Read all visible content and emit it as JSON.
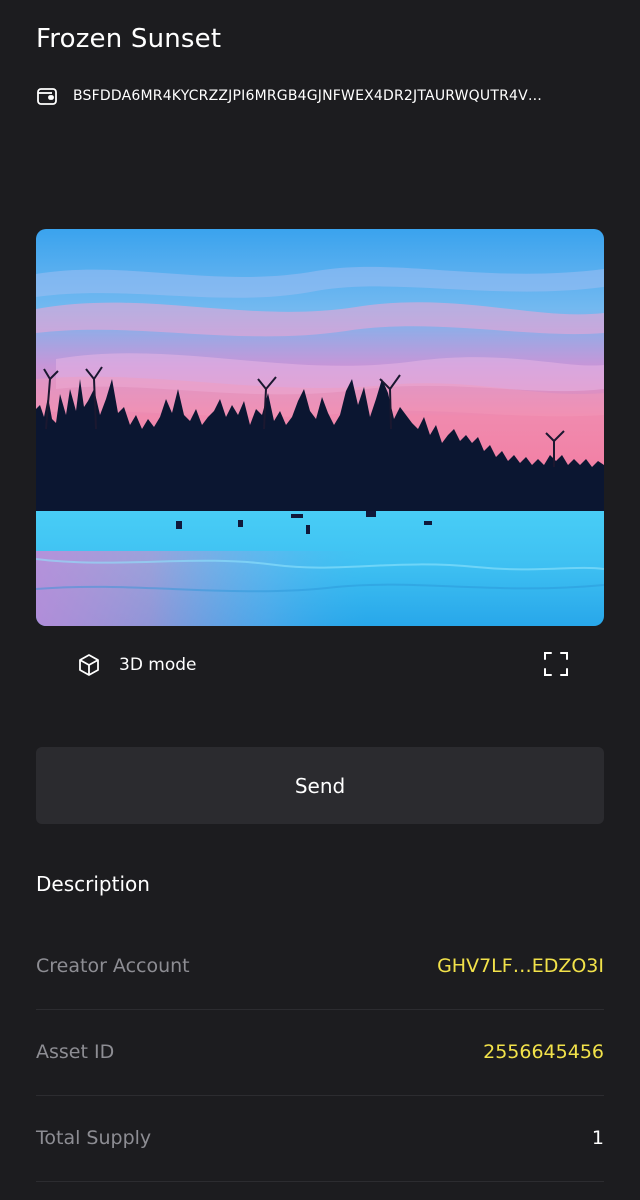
{
  "asset": {
    "name": "Frozen Sunset",
    "address": "BSFDDA6MR4KYCRZZJPI6MRGB4GJNFWEX4DR2JTAURWQUTR4V…"
  },
  "media": {
    "mode_label": "3D mode"
  },
  "actions": {
    "send_label": "Send"
  },
  "description": {
    "heading": "Description",
    "rows": [
      {
        "label": "Creator Account",
        "value": "GHV7LF…EDZO3I"
      },
      {
        "label": "Asset ID",
        "value": "2556645456"
      },
      {
        "label": "Total Supply",
        "value": "1"
      }
    ]
  },
  "colors": {
    "background": "#1c1c1f",
    "button": "#2b2b2f",
    "accent": "#f2e24a",
    "muted_text": "#8d8d93"
  },
  "icons": {
    "address": "wallet-icon",
    "mode": "cube-icon",
    "fullscreen": "fullscreen-icon"
  }
}
